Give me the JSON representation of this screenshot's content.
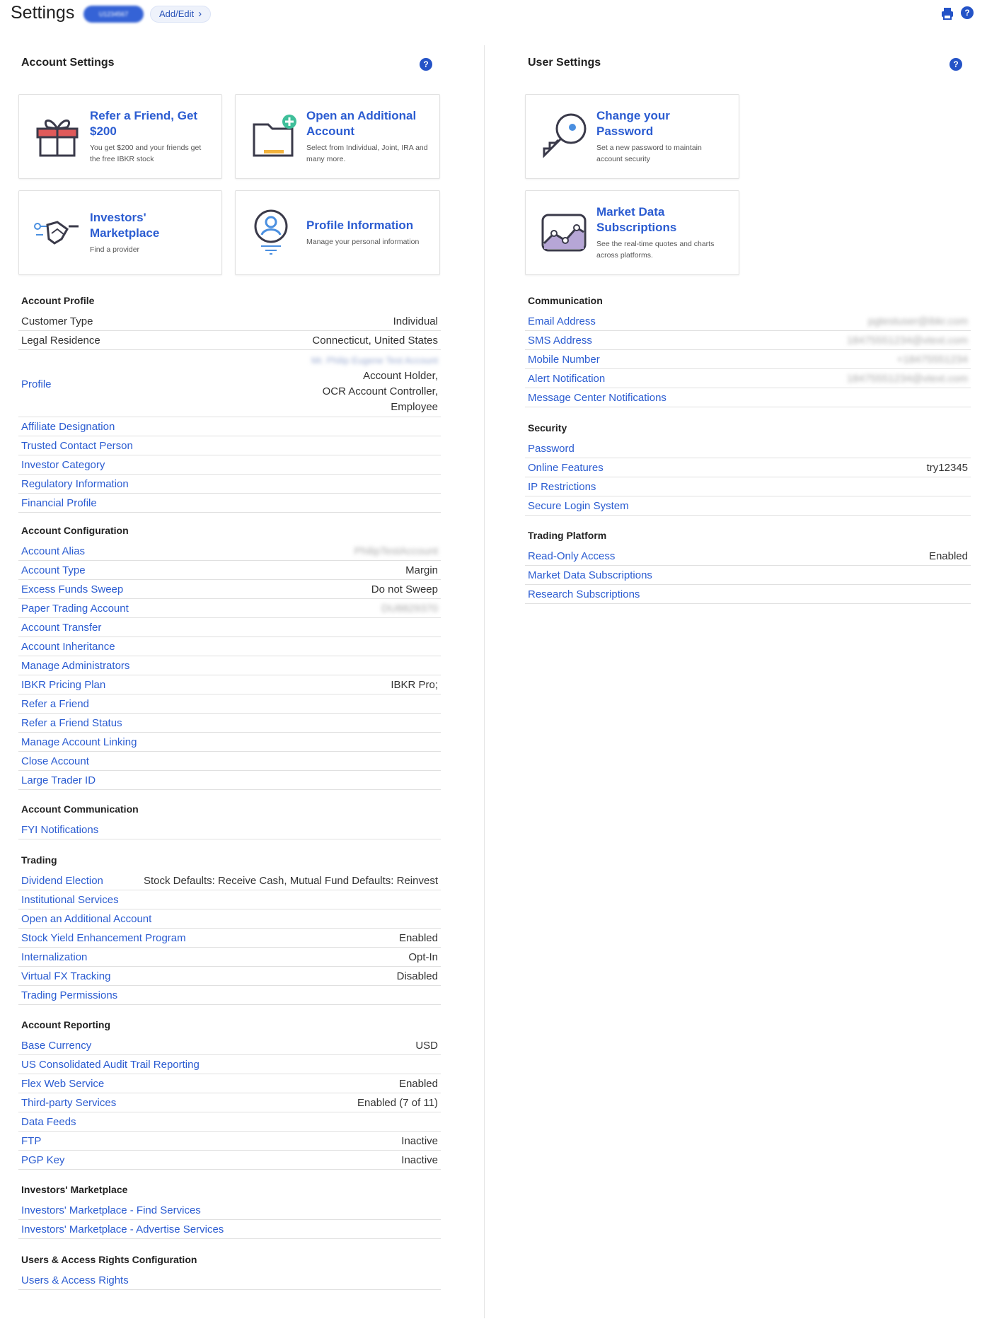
{
  "header": {
    "title": "Settings",
    "account_pill": "U1234567",
    "add_edit": "Add/Edit",
    "print_icon": "printer-icon",
    "help_icon": "help-icon"
  },
  "left": {
    "title": "Account Settings",
    "cards": [
      {
        "title": "Refer a Friend, Get $200",
        "desc": "You get $200 and your friends get the free IBKR stock",
        "icon": "gift-icon"
      },
      {
        "title": "Open an Additional Account",
        "desc": "Select from Individual, Joint, IRA and many more.",
        "icon": "folder-add-icon"
      },
      {
        "title": "Investors' Marketplace",
        "desc": "Find a provider",
        "icon": "handshake-icon"
      },
      {
        "title": "Profile Information",
        "desc": "Manage your personal information",
        "icon": "user-profile-icon"
      }
    ],
    "account_profile": {
      "heading": "Account Profile",
      "customer_type": {
        "label": "Customer Type",
        "value": "Individual"
      },
      "legal_residence": {
        "label": "Legal Residence",
        "value": "Connecticut, United States"
      },
      "profile": {
        "label": "Profile",
        "name": "Mr. Philip Eugene Test Account",
        "value_1": "Account Holder,",
        "value_2": "OCR Account Controller,",
        "value_3": "Employee"
      },
      "links": [
        "Affiliate Designation",
        "Trusted Contact Person",
        "Investor Category",
        "Regulatory Information",
        "Financial Profile"
      ]
    },
    "account_configuration": {
      "heading": "Account Configuration",
      "rows": [
        {
          "label": "Account Alias",
          "value": "PhilipTestAccount"
        },
        {
          "label": "Account Type",
          "value": "Margin"
        },
        {
          "label": "Excess Funds Sweep",
          "value": "Do not Sweep"
        },
        {
          "label": "Paper Trading Account",
          "value": "DU8829370"
        },
        {
          "label": "Account Transfer",
          "value": ""
        },
        {
          "label": "Account Inheritance",
          "value": ""
        },
        {
          "label": "Manage Administrators",
          "value": ""
        },
        {
          "label": "IBKR Pricing Plan",
          "value": "IBKR Pro;"
        },
        {
          "label": "Refer a Friend",
          "value": ""
        },
        {
          "label": "Refer a Friend Status",
          "value": ""
        },
        {
          "label": "Manage Account Linking",
          "value": ""
        },
        {
          "label": "Close Account",
          "value": ""
        },
        {
          "label": "Large Trader ID",
          "value": ""
        }
      ]
    },
    "account_communication": {
      "heading": "Account Communication",
      "rows": [
        {
          "label": "FYI Notifications",
          "value": ""
        }
      ]
    },
    "trading": {
      "heading": "Trading",
      "rows": [
        {
          "label": "Dividend Election",
          "value": "Stock Defaults: Receive Cash, Mutual Fund Defaults: Reinvest"
        },
        {
          "label": "Institutional Services",
          "value": ""
        },
        {
          "label": "Open an Additional Account",
          "value": ""
        },
        {
          "label": "Stock Yield Enhancement Program",
          "value": "Enabled"
        },
        {
          "label": "Internalization",
          "value": "Opt-In"
        },
        {
          "label": "Virtual FX Tracking",
          "value": "Disabled"
        },
        {
          "label": "Trading Permissions",
          "value": ""
        }
      ]
    },
    "account_reporting": {
      "heading": "Account Reporting",
      "rows": [
        {
          "label": "Base Currency",
          "value": "USD"
        },
        {
          "label": "US Consolidated Audit Trail Reporting",
          "value": ""
        },
        {
          "label": "Flex Web Service",
          "value": "Enabled"
        },
        {
          "label": "Third-party Services",
          "value": "Enabled (7 of 11)"
        },
        {
          "label": "Data Feeds",
          "value": ""
        },
        {
          "label": "FTP",
          "value": "Inactive"
        },
        {
          "label": "PGP Key",
          "value": "Inactive"
        }
      ]
    },
    "investors_marketplace": {
      "heading": "Investors' Marketplace",
      "rows": [
        {
          "label": "Investors' Marketplace - Find Services",
          "value": ""
        },
        {
          "label": "Investors' Marketplace - Advertise Services",
          "value": ""
        }
      ]
    },
    "users_access": {
      "heading": "Users & Access Rights Configuration",
      "rows": [
        {
          "label": "Users & Access Rights",
          "value": ""
        }
      ]
    }
  },
  "right": {
    "title": "User Settings",
    "cards": [
      {
        "title": "Change your Password",
        "desc": "Set a new password to maintain account security",
        "icon": "key-icon"
      },
      {
        "title": "Market Data Subscriptions",
        "desc": "See the real-time quotes and charts across platforms.",
        "icon": "market-chart-icon"
      }
    ],
    "communication": {
      "heading": "Communication",
      "rows": [
        {
          "label": "Email Address",
          "value": "pgtestuser@ibkr.com"
        },
        {
          "label": "SMS Address",
          "value": "18475551234@vtext.com"
        },
        {
          "label": "Mobile Number",
          "value": "+18475551234"
        },
        {
          "label": "Alert Notification",
          "value": "18475551234@vtext.com"
        },
        {
          "label": "Message Center Notifications",
          "value": ""
        }
      ]
    },
    "security": {
      "heading": "Security",
      "rows": [
        {
          "label": "Password",
          "value": ""
        },
        {
          "label": "Online Features",
          "value": "try12345"
        },
        {
          "label": "IP Restrictions",
          "value": ""
        },
        {
          "label": "Secure Login System",
          "value": ""
        }
      ]
    },
    "trading_platform": {
      "heading": "Trading Platform",
      "rows": [
        {
          "label": "Read-Only Access",
          "value": "Enabled"
        },
        {
          "label": "Market Data Subscriptions",
          "value": ""
        },
        {
          "label": "Research Subscriptions",
          "value": ""
        }
      ]
    }
  },
  "colors": {
    "accent": "#2b5cd1",
    "text": "#333333",
    "divider": "#e0e0e0"
  }
}
